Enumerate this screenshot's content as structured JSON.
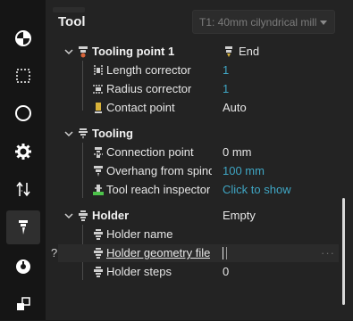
{
  "panel": {
    "title": "Tool",
    "tool_select": {
      "value": "T1: 40mm cilyndrical mill"
    }
  },
  "sidebar": {
    "items": [
      {
        "icon": "origin-target-icon"
      },
      {
        "icon": "selection-box-icon"
      },
      {
        "icon": "compass-icon"
      },
      {
        "icon": "gear-icon"
      },
      {
        "icon": "axis-move-icon"
      },
      {
        "icon": "tool-icon",
        "active": true
      },
      {
        "icon": "spindle-icon"
      },
      {
        "icon": "stack-icon"
      }
    ]
  },
  "tree": {
    "tooling_point": {
      "label": "Tooling point 1",
      "value": "End",
      "children": [
        {
          "label": "Length corrector",
          "value": "1"
        },
        {
          "label": "Radius corrector",
          "value": "1"
        },
        {
          "label": "Contact point",
          "value": "Auto"
        }
      ]
    },
    "tooling": {
      "label": "Tooling",
      "children": [
        {
          "label": "Connection point",
          "value": "0 mm"
        },
        {
          "label": "Overhang from spindl",
          "value": "100 mm"
        },
        {
          "label": "Tool reach inspector",
          "value": "Click to show"
        }
      ]
    },
    "holder": {
      "label": "Holder",
      "value": "Empty",
      "children": [
        {
          "label": "Holder name",
          "value": ""
        },
        {
          "label": "Holder geometry file",
          "value": ""
        },
        {
          "label": "Holder steps",
          "value": "0"
        }
      ]
    },
    "help_mark": "?",
    "more_mark": "···"
  }
}
